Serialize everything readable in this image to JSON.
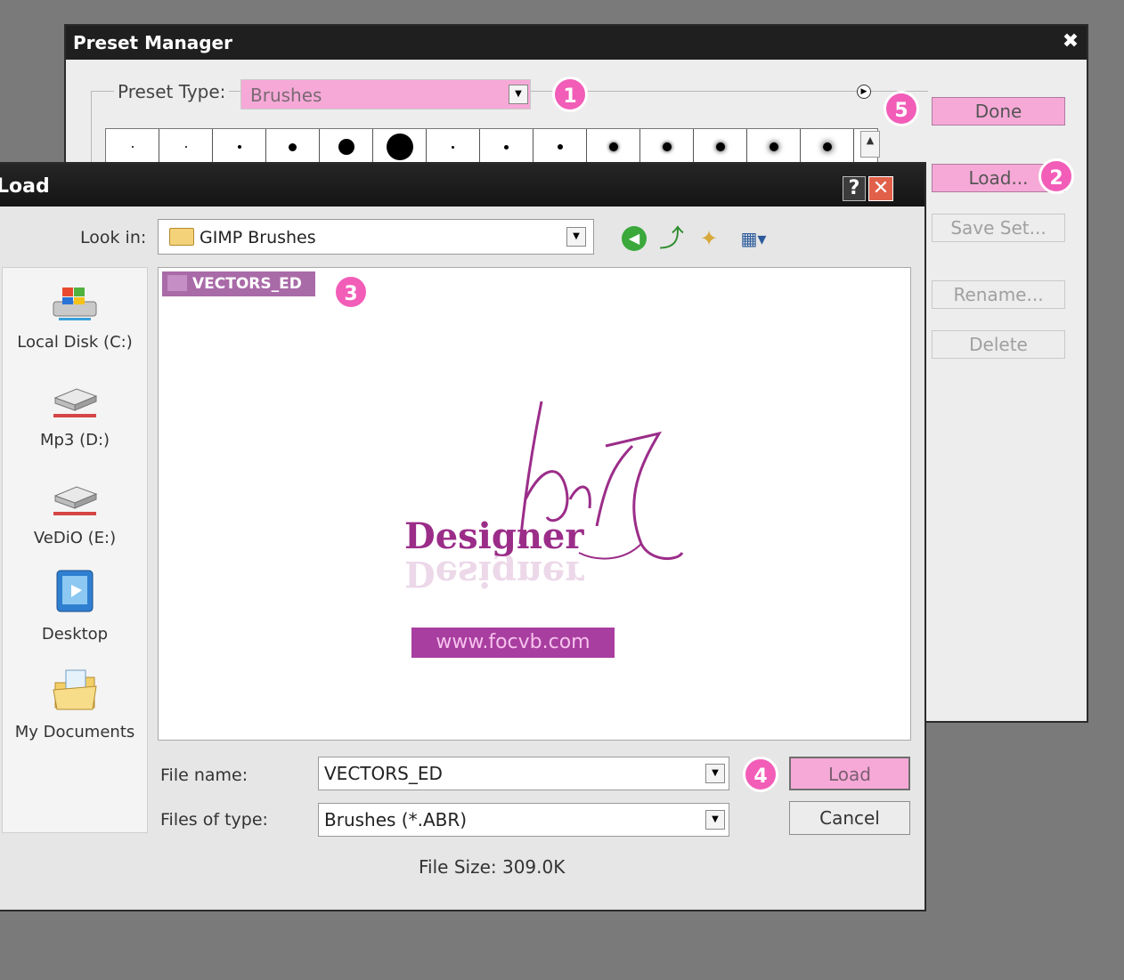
{
  "preset_manager": {
    "title": "Preset Manager",
    "close_label": "✖",
    "preset_type_label": "Preset Type:",
    "preset_type_value": "Brushes",
    "buttons": {
      "done": "Done",
      "load": "Load...",
      "save_set": "Save Set...",
      "rename": "Rename...",
      "delete": "Delete"
    }
  },
  "load_dialog": {
    "title": "Load",
    "help_label": "?",
    "close_label": "✕",
    "look_in_label": "Look in:",
    "look_in_value": "GIMP Brushes",
    "places": [
      {
        "label": "Local Disk (C:)",
        "icon": "local-disk-icon"
      },
      {
        "label": "Mp3 (D:)",
        "icon": "drive-icon"
      },
      {
        "label": "VeDiO (E:)",
        "icon": "drive-icon"
      },
      {
        "label": "Desktop",
        "icon": "desktop-icon"
      },
      {
        "label": "My Documents",
        "icon": "my-documents-icon"
      }
    ],
    "file_item": "VECTORS_ED",
    "preview": {
      "script_text": "max",
      "word": "Designer",
      "url": "www.focvb.com"
    },
    "file_name_label": "File name:",
    "file_name_value": "VECTORS_ED",
    "files_of_type_label": "Files of type:",
    "files_of_type_value": "Brushes (*.ABR)",
    "load_button": "Load",
    "cancel_button": "Cancel",
    "file_size": "File Size: 309.0K"
  },
  "badges": [
    "1",
    "2",
    "3",
    "4",
    "5"
  ],
  "colors": {
    "accent_pink": "#f6a9d7",
    "badge_pink": "#f25db8",
    "title_bar": "#1f1f1f",
    "selection": "#a96aa8"
  }
}
